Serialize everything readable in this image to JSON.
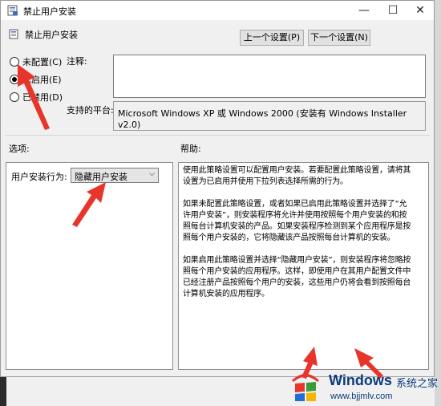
{
  "window": {
    "title": "禁止用户安装",
    "minimize_glyph": "—",
    "maximize_glyph": "☐",
    "close_glyph": "✕"
  },
  "header": {
    "policy_name": "禁止用户安装",
    "prev_button": "上一个设置(P)",
    "next_button": "下一个设置(N)"
  },
  "state": {
    "options": [
      {
        "label": "未配置(C)",
        "checked": false
      },
      {
        "label": "已启用(E)",
        "checked": true
      },
      {
        "label": "已禁用(D)",
        "checked": false
      }
    ]
  },
  "comment": {
    "label": "注释:",
    "value": ""
  },
  "platform": {
    "label": "支持的平台:",
    "value": "Microsoft Windows XP 或 Windows 2000 (安装有 Windows Installer v2.0)"
  },
  "sections": {
    "options_label": "选项:",
    "help_label": "帮助:"
  },
  "options_pane": {
    "field_label": "用户安装行为:",
    "selected_value": "隐藏用户安装"
  },
  "help": {
    "paragraphs": [
      "使用此策略设置可以配置用户安装。若要配置此策略设置，请将其设置为已启用并使用下拉列表选择所需的行为。",
      "如果未配置此策略设置，或者如果已启用此策略设置并选择了“允许用户安装”，则安装程序将允许并使用按照每个用户安装的和按照每台计算机安装的产品。如果安装程序检测到某个应用程序是按照每个用户安装的，它将隐藏该产品按照每台计算机的安装。",
      "如果启用此策略设置并选择“隐藏用户安装”，则安装程序将忽略按照每个用户安装的应用程序。这样，即使用户在其用户配置文件中已经注册产品按照每个用户的安装，这些用户仍将会看到按照每台计算机安装的应用程序。"
    ]
  },
  "watermark": {
    "brand": "Windows",
    "site_cn": "系统之家",
    "url": "www.bjjmlv.com"
  },
  "colors": {
    "arrow_red": "#e8352b",
    "brand_blue": "#0b3b7a"
  }
}
